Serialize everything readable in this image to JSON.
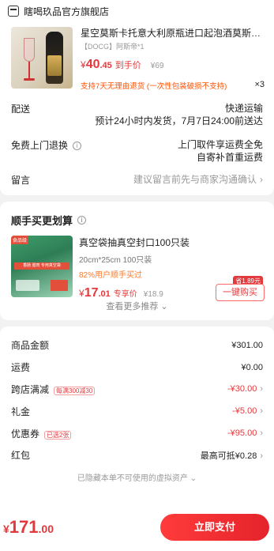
{
  "store": {
    "name": "瞎喝玖品官方旗舰店",
    "product": {
      "title": "星空莫斯卡托意大利原瓶进口起泡酒莫斯卡...",
      "sku": "【DOCG】阿斯帝*1",
      "price_symbol": "¥",
      "price_int": "40",
      "price_dec": ".45",
      "price_tag": "到手价",
      "orig_price": "¥69",
      "qty": "×3",
      "return_note": "支持7天无理由退货 (一次性包装破损不支持)"
    },
    "delivery": {
      "label": "配送",
      "method": "快递运输",
      "eta": "预计24小时内发货，7月7日24:00前送达"
    },
    "free_return": {
      "label": "免费上门退换",
      "line1": "上门取件享运费全免",
      "line2": "自寄补首重运费"
    },
    "remark": {
      "label": "留言",
      "placeholder": "建议留言前先与商家沟通确认"
    }
  },
  "addon": {
    "title": "顺手买更划算",
    "img_badge": "食品级",
    "img_strip": "香肠 腊肉 专用真空袋",
    "product_title": "真空袋抽真空封口100只装",
    "spec": "20cm*25cm 100只装",
    "pct": "82%用户顺手买过",
    "price_symbol": "¥",
    "price_int": "17",
    "price_dec": ".01",
    "price_tag": "专享价",
    "orig_price": "¥18.9",
    "save_badge": "省1.89元",
    "buy_label": "一键购买",
    "more_label": "查看更多推荐"
  },
  "summary": {
    "rows": [
      {
        "label": "商品金额",
        "value": "¥301.00",
        "tag": "",
        "red": false
      },
      {
        "label": "运费",
        "value": "¥0.00",
        "tag": "",
        "red": false
      },
      {
        "label": "跨店满减",
        "value": "-¥30.00",
        "tag": "每满300减30",
        "red": true
      },
      {
        "label": "礼金",
        "value": "-¥5.00",
        "tag": "",
        "red": true
      },
      {
        "label": "优惠券",
        "value": "-¥95.00",
        "tag": "已选2张",
        "red": true
      },
      {
        "label": "红包",
        "value": "最高可抵¥0.28",
        "tag": "",
        "red": false
      }
    ],
    "hidden_note": "已隐藏本单不可使用的虚拟资产"
  },
  "bottom": {
    "total_symbol": "¥",
    "total_int": "171",
    "total_dec": ".00",
    "pay_label": "立即支付"
  },
  "colors": {
    "accent": "#e4393c",
    "orange": "#ff5000"
  }
}
